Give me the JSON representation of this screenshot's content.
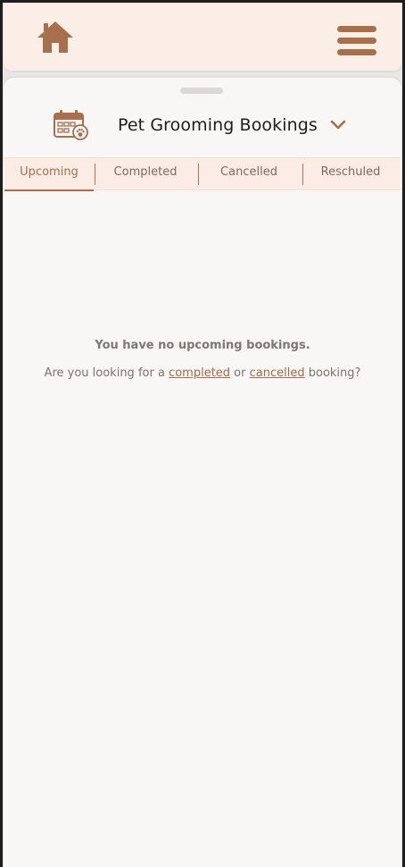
{
  "header": {
    "home_icon": "home-icon",
    "menu_icon": "hamburger-menu-icon"
  },
  "sheet": {
    "title": "Pet Grooming Bookings",
    "title_icon": "calendar-paw-icon",
    "dropdown_icon": "chevron-down-icon"
  },
  "tabs": [
    {
      "label": "Upcoming",
      "active": true
    },
    {
      "label": "Completed",
      "active": false
    },
    {
      "label": "Cancelled",
      "active": false
    },
    {
      "label": "Reschuled",
      "active": false
    }
  ],
  "empty_state": {
    "title": "You have no upcoming bookings.",
    "prefix": "Are you looking for a ",
    "link_completed": "completed",
    "middle": " or ",
    "link_cancelled": "cancelled",
    "suffix": " booking?"
  },
  "colors": {
    "accent": "#ad6e49",
    "header_bg": "#faeee6",
    "sheet_bg": "#f8f7f5"
  }
}
